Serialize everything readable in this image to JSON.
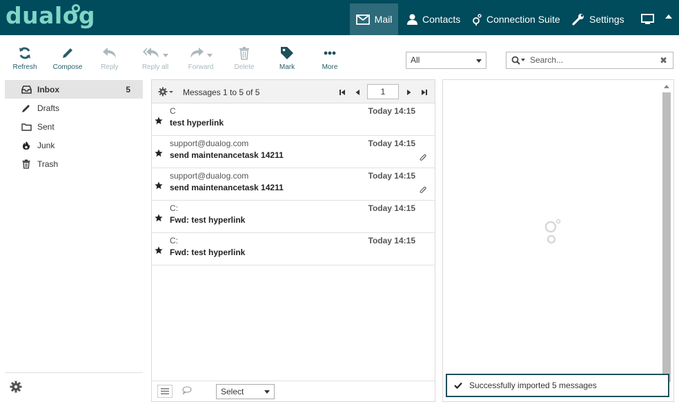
{
  "brand": {
    "logo_text": "dualog"
  },
  "nav": {
    "mail": "Mail",
    "contacts": "Contacts",
    "connection_suite": "Connection Suite",
    "settings": "Settings"
  },
  "toolbar": {
    "refresh": "Refresh",
    "compose": "Compose",
    "reply": "Reply",
    "reply_all": "Reply all",
    "forward": "Forward",
    "delete": "Delete",
    "mark": "Mark",
    "more": "More"
  },
  "filter": {
    "selected": "All"
  },
  "search": {
    "placeholder": "Search..."
  },
  "folders": [
    {
      "name": "Inbox",
      "count": "5",
      "icon": "inbox-icon"
    },
    {
      "name": "Drafts",
      "count": "",
      "icon": "pencil-icon"
    },
    {
      "name": "Sent",
      "count": "",
      "icon": "folder-icon"
    },
    {
      "name": "Junk",
      "count": "",
      "icon": "fire-icon"
    },
    {
      "name": "Trash",
      "count": "",
      "icon": "trash-icon"
    }
  ],
  "message_list": {
    "count_text": "Messages 1 to 5 of 5",
    "page": "1",
    "messages": [
      {
        "from": "C",
        "time": "Today 14:15",
        "subject": "test hyperlink",
        "attachment": false
      },
      {
        "from": "support@dualog.com",
        "time": "Today 14:15",
        "subject": "send maintenancetask 14211",
        "attachment": true
      },
      {
        "from": "support@dualog.com",
        "time": "Today 14:15",
        "subject": "send maintenancetask 14211",
        "attachment": true
      },
      {
        "from": "C:",
        "time": "Today 14:15",
        "subject": "Fwd: test hyperlink",
        "attachment": false
      },
      {
        "from": "C:",
        "time": "Today 14:15",
        "subject": "Fwd: test hyperlink",
        "attachment": false
      }
    ],
    "select_label": "Select"
  },
  "toast": {
    "message": "Successfully imported 5 messages"
  },
  "colors": {
    "header_bg": "#004b5c",
    "accent": "#2a5d6b",
    "logo": "#7fd6c7"
  }
}
